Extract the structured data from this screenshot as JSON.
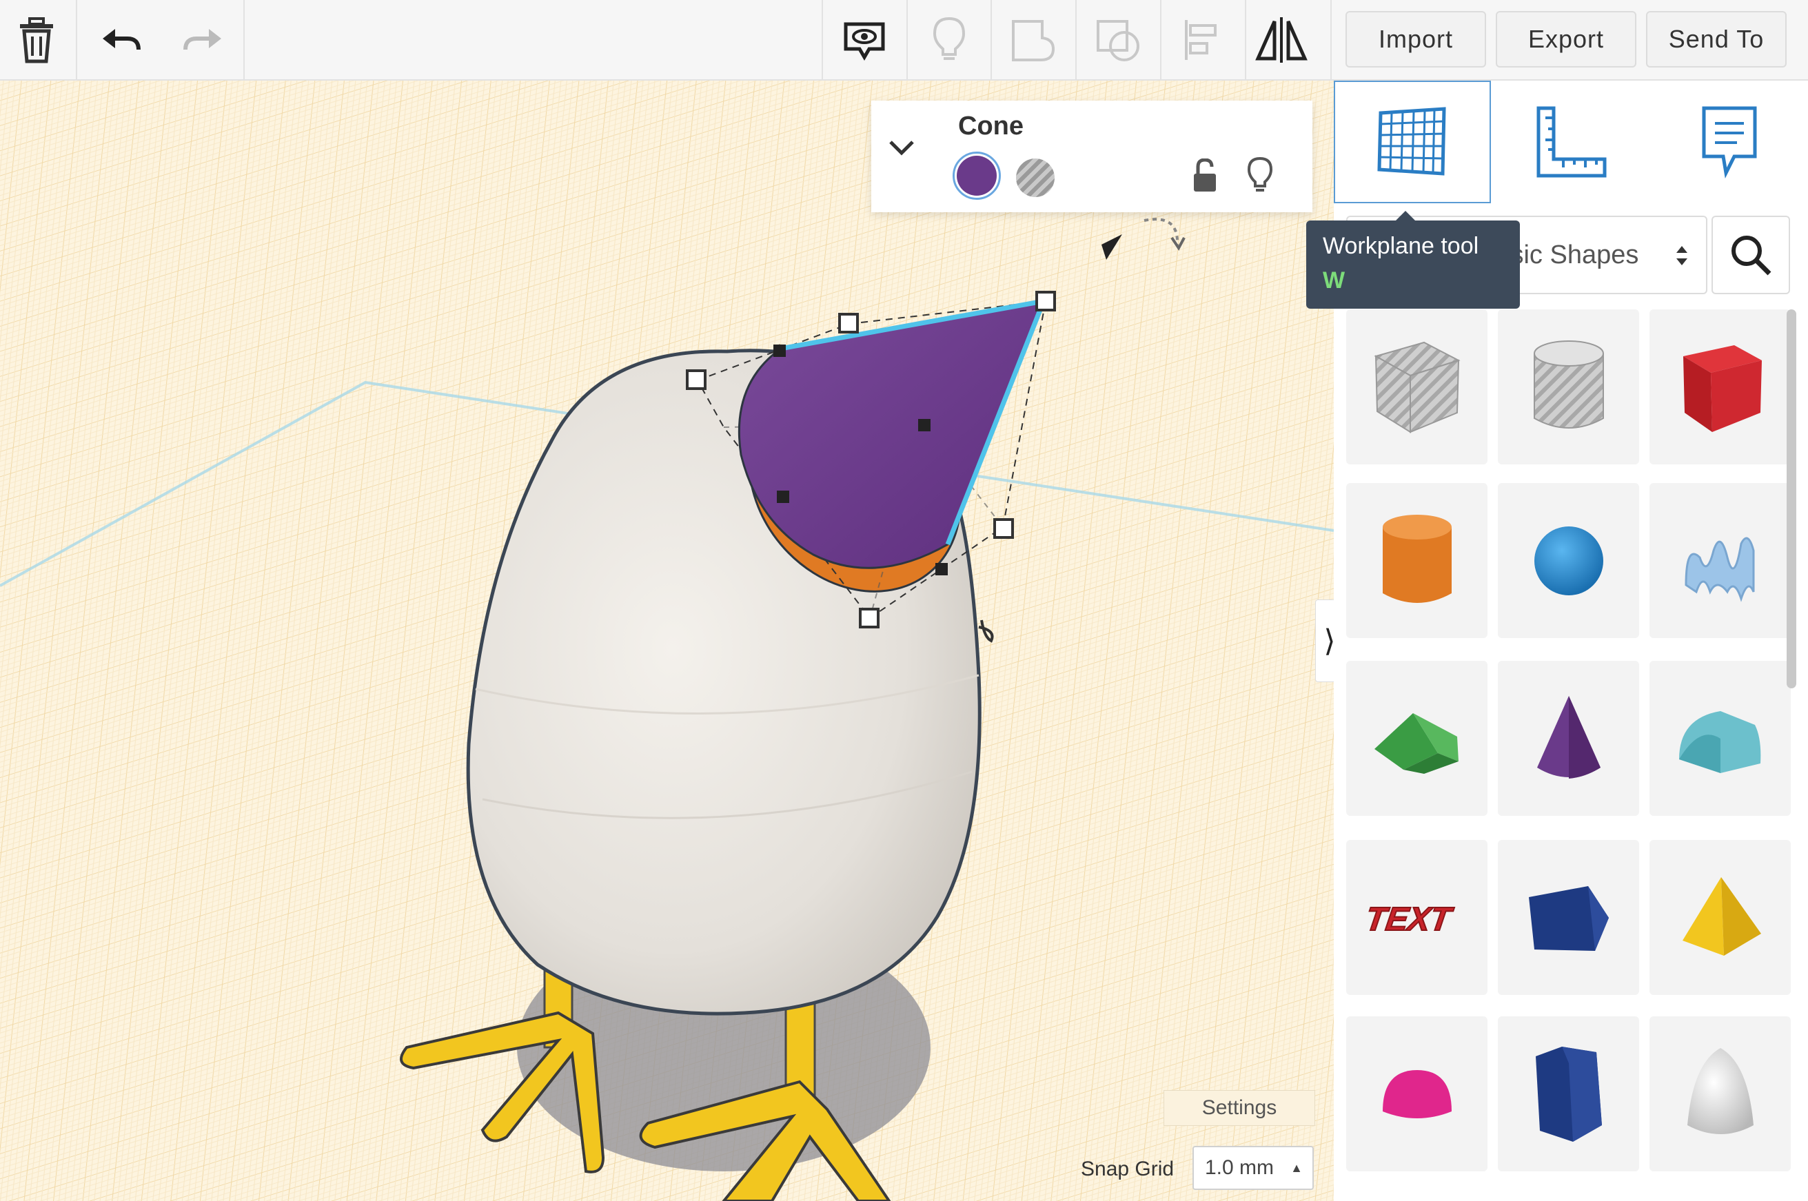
{
  "toolbar": {
    "delete_icon": "trash-icon",
    "undo_icon": "undo-icon",
    "redo_icon": "redo-icon",
    "view_icon": "show-all-icon",
    "light_icon": "lightbulb-icon",
    "group_icon": "group-icon",
    "ungroup_icon": "ungroup-icon",
    "align_icon": "align-icon",
    "mirror_icon": "mirror-icon",
    "import_label": "Import",
    "export_label": "Export",
    "send_to_label": "Send To"
  },
  "inspector": {
    "title": "Cone",
    "solid_color": "#6a3a8a",
    "lock_icon": "unlock-icon",
    "light_icon": "lightbulb-icon"
  },
  "panel": {
    "tabs": [
      {
        "name": "workplane",
        "icon": "workplane-grid-icon"
      },
      {
        "name": "ruler",
        "icon": "ruler-icon"
      },
      {
        "name": "notes",
        "icon": "notes-icon"
      }
    ],
    "tooltip": {
      "title": "Workplane tool",
      "shortcut": "W"
    },
    "category_value": "Basic Shapes",
    "search_icon": "search-icon",
    "shapes": [
      {
        "name": "Box Hole",
        "color": "#c8c8c8"
      },
      {
        "name": "Cylinder Hole",
        "color": "#d0d0d0"
      },
      {
        "name": "Box",
        "color": "#d0262c"
      },
      {
        "name": "Cylinder",
        "color": "#e07a23"
      },
      {
        "name": "Sphere",
        "color": "#1e8ad6"
      },
      {
        "name": "Scribble",
        "color": "#8fb8e0"
      },
      {
        "name": "Roof",
        "color": "#3fa34a"
      },
      {
        "name": "Cone",
        "color": "#6a3a8a"
      },
      {
        "name": "Round Roof",
        "color": "#6cc0cc"
      },
      {
        "name": "Text",
        "color": "#c8232a"
      },
      {
        "name": "Wedge",
        "color": "#1e3a82"
      },
      {
        "name": "Pyramid",
        "color": "#f2c61f"
      },
      {
        "name": "Half Sphere",
        "color": "#e0268c"
      },
      {
        "name": "Polygon",
        "color": "#1e3a82"
      },
      {
        "name": "Paraboloid",
        "color": "#d8d8d8"
      }
    ]
  },
  "viewport": {
    "settings_label": "Settings",
    "snap_label": "Snap Grid",
    "snap_value": "1.0 mm"
  }
}
